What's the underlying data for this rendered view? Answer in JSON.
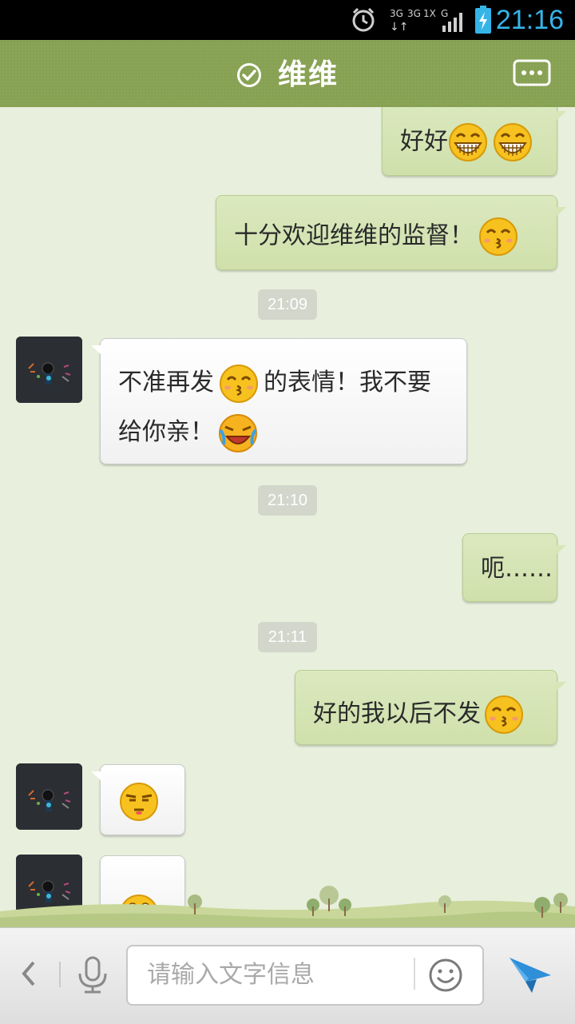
{
  "status_bar": {
    "time": "21:16",
    "network_labels": [
      "3G",
      "3G",
      "1X",
      "G"
    ],
    "icons": [
      "alarm-icon",
      "signal-icon",
      "battery-charging-icon"
    ]
  },
  "header": {
    "contact_name": "维维",
    "verified_icon": "check-circle-icon",
    "menu_icon": "chat-menu-icon"
  },
  "messages": [
    {
      "id": "m1",
      "direction": "outgoing",
      "text": "好好",
      "emoji": [
        "grin",
        "grin"
      ]
    },
    {
      "id": "m2",
      "direction": "outgoing",
      "text": "十分欢迎维维的监督！",
      "emoji": [
        "kiss"
      ]
    },
    {
      "id": "t1",
      "type": "timestamp",
      "text": "21:09"
    },
    {
      "id": "m3",
      "direction": "incoming",
      "text_a": "不准再发",
      "text_b": "的表情！我不要",
      "text_c": "给你亲！",
      "emoji": [
        "kiss",
        "cry-laugh"
      ]
    },
    {
      "id": "t2",
      "type": "timestamp",
      "text": "21:10"
    },
    {
      "id": "m4",
      "direction": "outgoing",
      "text": "呃……"
    },
    {
      "id": "t3",
      "type": "timestamp",
      "text": "21:11"
    },
    {
      "id": "m5",
      "direction": "outgoing",
      "text": "好的我以后不发",
      "emoji": [
        "kiss"
      ]
    },
    {
      "id": "m6",
      "direction": "incoming",
      "text": "",
      "emoji": [
        "unamused"
      ]
    },
    {
      "id": "m7",
      "direction": "incoming",
      "text": "",
      "emoji": [
        "peek"
      ]
    }
  ],
  "input_bar": {
    "placeholder": "请输入文字信息",
    "icons": [
      "back-icon",
      "mic-icon",
      "emoji-icon",
      "send-icon"
    ]
  },
  "colors": {
    "header": "#8aa456",
    "time": "#35b4e8",
    "outgoing_bubble": "#d6e6b7",
    "incoming_bubble": "#ffffff",
    "send": "#2f8fd8"
  }
}
